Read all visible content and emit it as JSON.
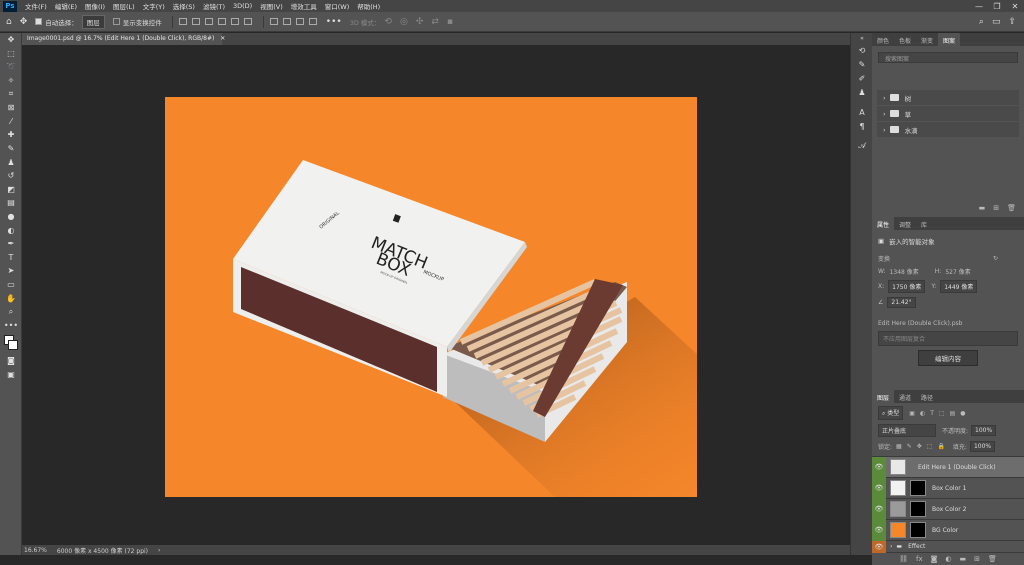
{
  "app": {
    "logo": "Ps"
  },
  "menu": [
    "文件(F)",
    "编辑(E)",
    "图像(I)",
    "图层(L)",
    "文字(Y)",
    "选择(S)",
    "滤镜(T)",
    "3D(D)",
    "视图(V)",
    "增效工具",
    "窗口(W)",
    "帮助(H)"
  ],
  "window_controls": [
    "—",
    "❐",
    "✕"
  ],
  "options": {
    "auto_select": "自动选择：",
    "layer_select": "图层",
    "show_transform": "显示变换控件",
    "mode_3d": "3D 模式："
  },
  "document": {
    "tab_title": "Image0001.psd @ 16.7% (Edit Here 1 (Double Click), RGB/8#)",
    "tab_close": "✕"
  },
  "status": {
    "zoom": "16.67%",
    "info": "6000 像素 x 4500 像素 (72 ppi)",
    "arrow": "›"
  },
  "mockup": {
    "text_original": "ORIGINAL",
    "text_match": "MATCH",
    "text_box": "BOX",
    "text_mockup": "MOCKUP",
    "text_small": "MOCK-UP ORIGINAL"
  },
  "library_panel": {
    "tabs": [
      "颜色",
      "色板",
      "渐变",
      "图案"
    ],
    "active_tab": 3,
    "search_placeholder": "搜索图案",
    "folders": [
      "树",
      "草",
      "水滴"
    ]
  },
  "properties_panel": {
    "tabs": [
      "属性",
      "调整",
      "库"
    ],
    "active_tab": 0,
    "title": "嵌入的智能对象",
    "transform_label": "变换",
    "w_label": "W:",
    "w_value": "1348 像素",
    "h_label": "H:",
    "h_value": "527 像素",
    "x_label": "X:",
    "x_value": "1750 像素",
    "y_label": "Y:",
    "y_value": "1449 像素",
    "angle_value": "21.42°",
    "file_name": "Edit Here (Double Click).psb",
    "comp_placeholder": "不应用图层复合",
    "edit_button": "编辑内容"
  },
  "layers_panel": {
    "tabs": [
      "图层",
      "通道",
      "路径"
    ],
    "active_tab": 0,
    "filter_kind": "类型",
    "blend_mode": "正片叠底",
    "opacity_label": "不透明度:",
    "opacity_value": "100%",
    "lock_label": "锁定:",
    "fill_label": "填充:",
    "fill_value": "100%",
    "layers": [
      {
        "name": "Edit Here 1 (Double Click)",
        "thumb": "#e8e8e8",
        "mask": false,
        "selected": true
      },
      {
        "name": "Box Color 1",
        "thumb": "#f2f2f2",
        "mask": true,
        "selected": false
      },
      {
        "name": "Box Color 2",
        "thumb": "#9a9a9a",
        "mask": true,
        "selected": false
      },
      {
        "name": "BG Color",
        "thumb": "#f5862a",
        "mask": true,
        "selected": false
      },
      {
        "name": "Effect",
        "thumb": "",
        "mask": false,
        "selected": false,
        "group": true
      }
    ]
  },
  "colors": {
    "accent": "#f5862a",
    "eye_bg": "#5a8a3a",
    "panel": "#535353"
  }
}
